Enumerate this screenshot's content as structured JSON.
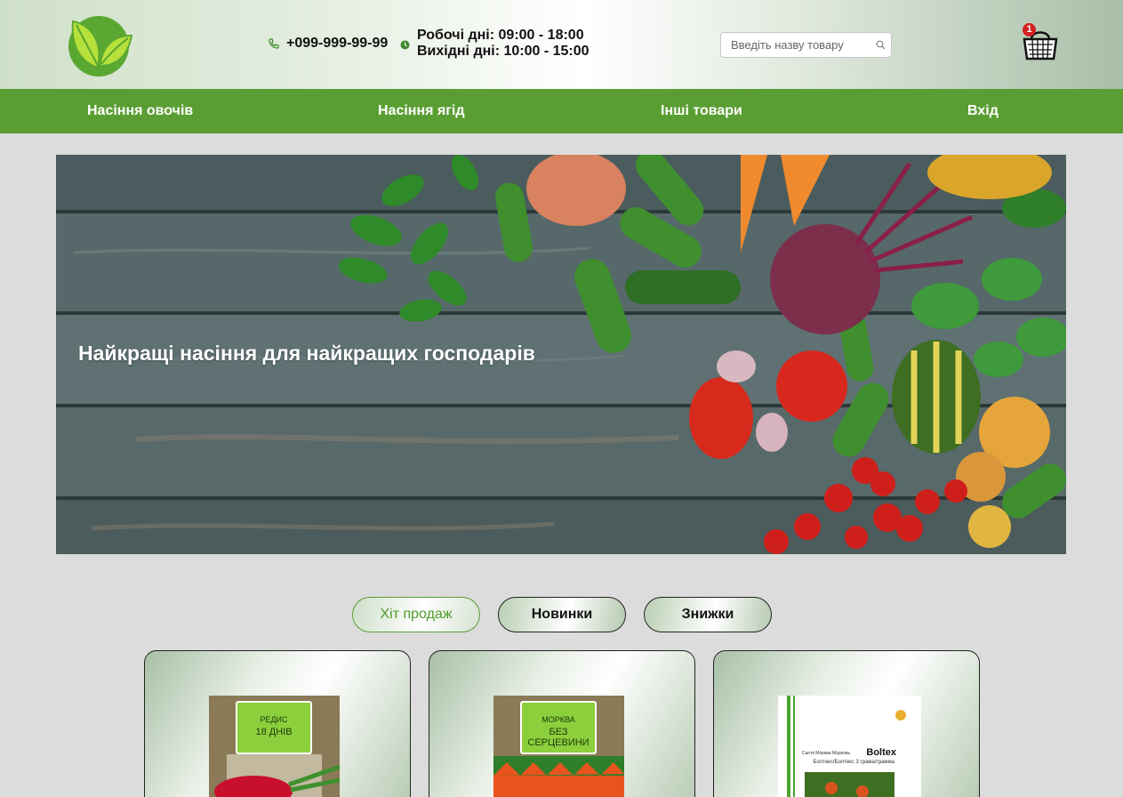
{
  "header": {
    "phone": "+099-999-99-99",
    "hours_weekdays": "Робочі дні: 09:00 - 18:00",
    "hours_weekend": "Вихідні дні: 10:00 - 15:00",
    "search_placeholder": "Введіть назву товару",
    "cart_count": "1",
    "icons": {
      "logo": "leaf-logo",
      "phone": "phone-icon",
      "clock": "clock-icon",
      "search": "search-icon",
      "cart": "basket-icon"
    }
  },
  "nav": {
    "items": [
      {
        "label": "Насіння овочів"
      },
      {
        "label": "Насіння ягід"
      },
      {
        "label": "Інші товари"
      },
      {
        "label": "Вхід"
      }
    ]
  },
  "hero": {
    "title": "Найкращі насіння для найкращих господарів"
  },
  "tabs": [
    {
      "label": "Хіт продаж",
      "active": true
    },
    {
      "label": "Новинки",
      "active": false
    },
    {
      "label": "Знижки",
      "active": false
    }
  ],
  "products": [
    {
      "label_line1": "РЕДИС",
      "label_line2": "18 ДНІВ"
    },
    {
      "label_line1": "МОРКВА",
      "label_line2": "БЕЗ СЕРЦЕВИНИ"
    },
    {
      "brand": "Boltex",
      "sub": "Болтекс/Болтекс 3 грама/грамма",
      "side_text": "Carrot Морква Морковь"
    }
  ],
  "colors": {
    "nav_green": "#5a9e33",
    "active_tab_text": "#4f9a2a",
    "badge_red": "#d41f1f",
    "page_bg": "#dcdcdc"
  }
}
